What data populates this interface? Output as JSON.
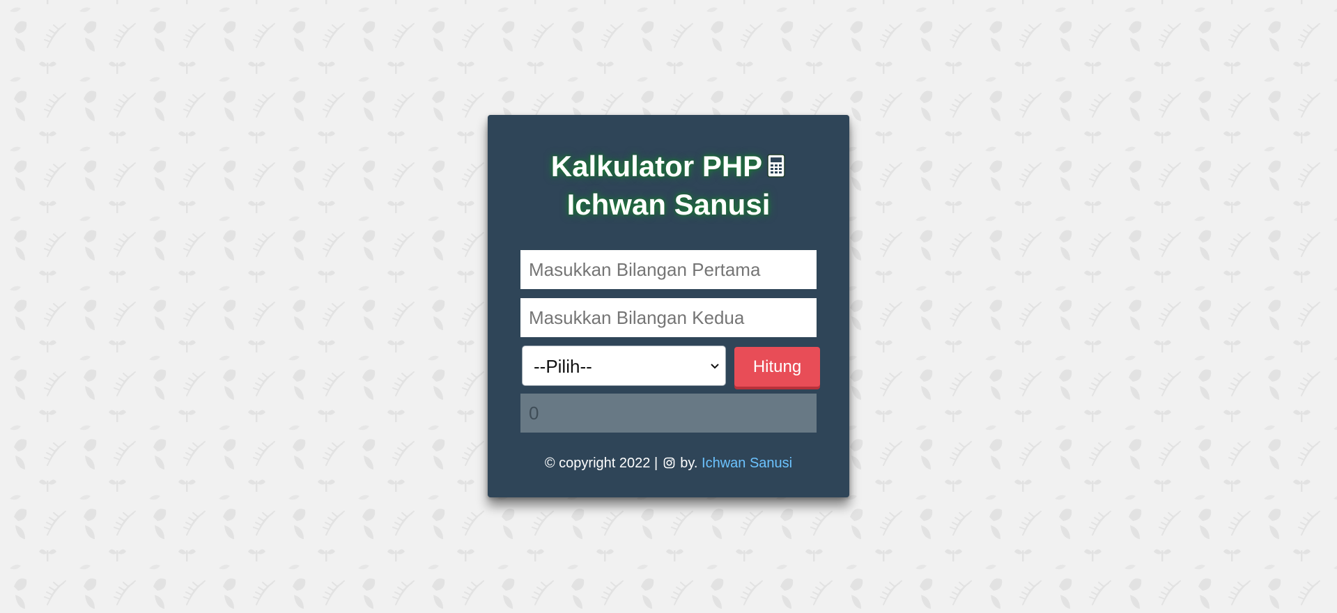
{
  "colors": {
    "page_background": "#f1f1f1",
    "card_background": "#2f4558",
    "title_glow": "#1f7a3a",
    "button_background": "#e84d57",
    "result_background": "#687985",
    "link": "#6cc3ff"
  },
  "card": {
    "title_line1": "Kalkulator PHP",
    "title_icon": "calculator-icon",
    "title_line2": "Ichwan Sanusi"
  },
  "form": {
    "first_number_placeholder": "Masukkan Bilangan Pertama",
    "second_number_placeholder": "Masukkan Bilangan Kedua",
    "operator_selected": "--Pilih--",
    "submit_label": "Hitung",
    "result_value": "0"
  },
  "footer": {
    "copyright": "© copyright 2022 |",
    "icon": "instagram-icon",
    "by": "by.",
    "author_link": "Ichwan Sanusi"
  }
}
